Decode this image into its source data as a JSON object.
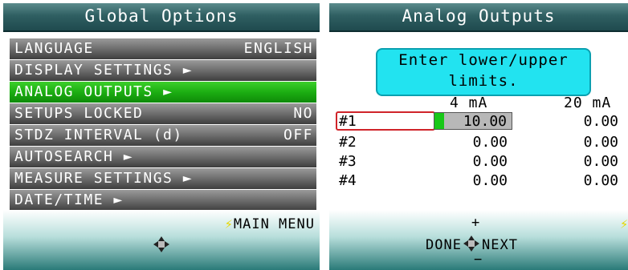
{
  "global_options": {
    "title": "Global Options",
    "items": [
      {
        "label": "LANGUAGE",
        "value": "ENGLISH",
        "arrow": ""
      },
      {
        "label": "DISPLAY SETTINGS",
        "value": "",
        "arrow": "►"
      },
      {
        "label": "ANALOG OUTPUTS",
        "value": "",
        "arrow": "►"
      },
      {
        "label": "SETUPS LOCKED",
        "value": "NO",
        "arrow": ""
      },
      {
        "label": "STDZ INTERVAL (d)",
        "value": "OFF",
        "arrow": ""
      },
      {
        "label": "AUTOSEARCH",
        "value": "",
        "arrow": "►"
      },
      {
        "label": "MEASURE SETTINGS",
        "value": "",
        "arrow": "►"
      },
      {
        "label": "DATE/TIME",
        "value": "",
        "arrow": "►"
      }
    ],
    "selected_index": 2,
    "footer_label": "MAIN MENU",
    "bolt_glyph": "⚡"
  },
  "analog_outputs": {
    "title": "Analog Outputs",
    "instruction_line1": "Enter lower/upper",
    "instruction_line2": "limits.",
    "col_low": "4 mA",
    "col_high": "20 mA",
    "rows": [
      {
        "label": "#1",
        "low": "10.00",
        "high": "0.00"
      },
      {
        "label": "#2",
        "low": "0.00",
        "high": "0.00"
      },
      {
        "label": "#3",
        "low": "0.00",
        "high": "0.00"
      },
      {
        "label": "#4",
        "low": "0.00",
        "high": "0.00"
      }
    ],
    "nav_plus": "+",
    "nav_minus": "−",
    "nav_done": "DONE",
    "nav_next": "NEXT",
    "bolt_glyph": "⚡"
  },
  "colors": {
    "title_bg": "#2f5f62",
    "selected": "#1cae12",
    "instruction_bg": "#22e3f0",
    "active_border": "#d0242a",
    "bolt": "#e6d800"
  }
}
